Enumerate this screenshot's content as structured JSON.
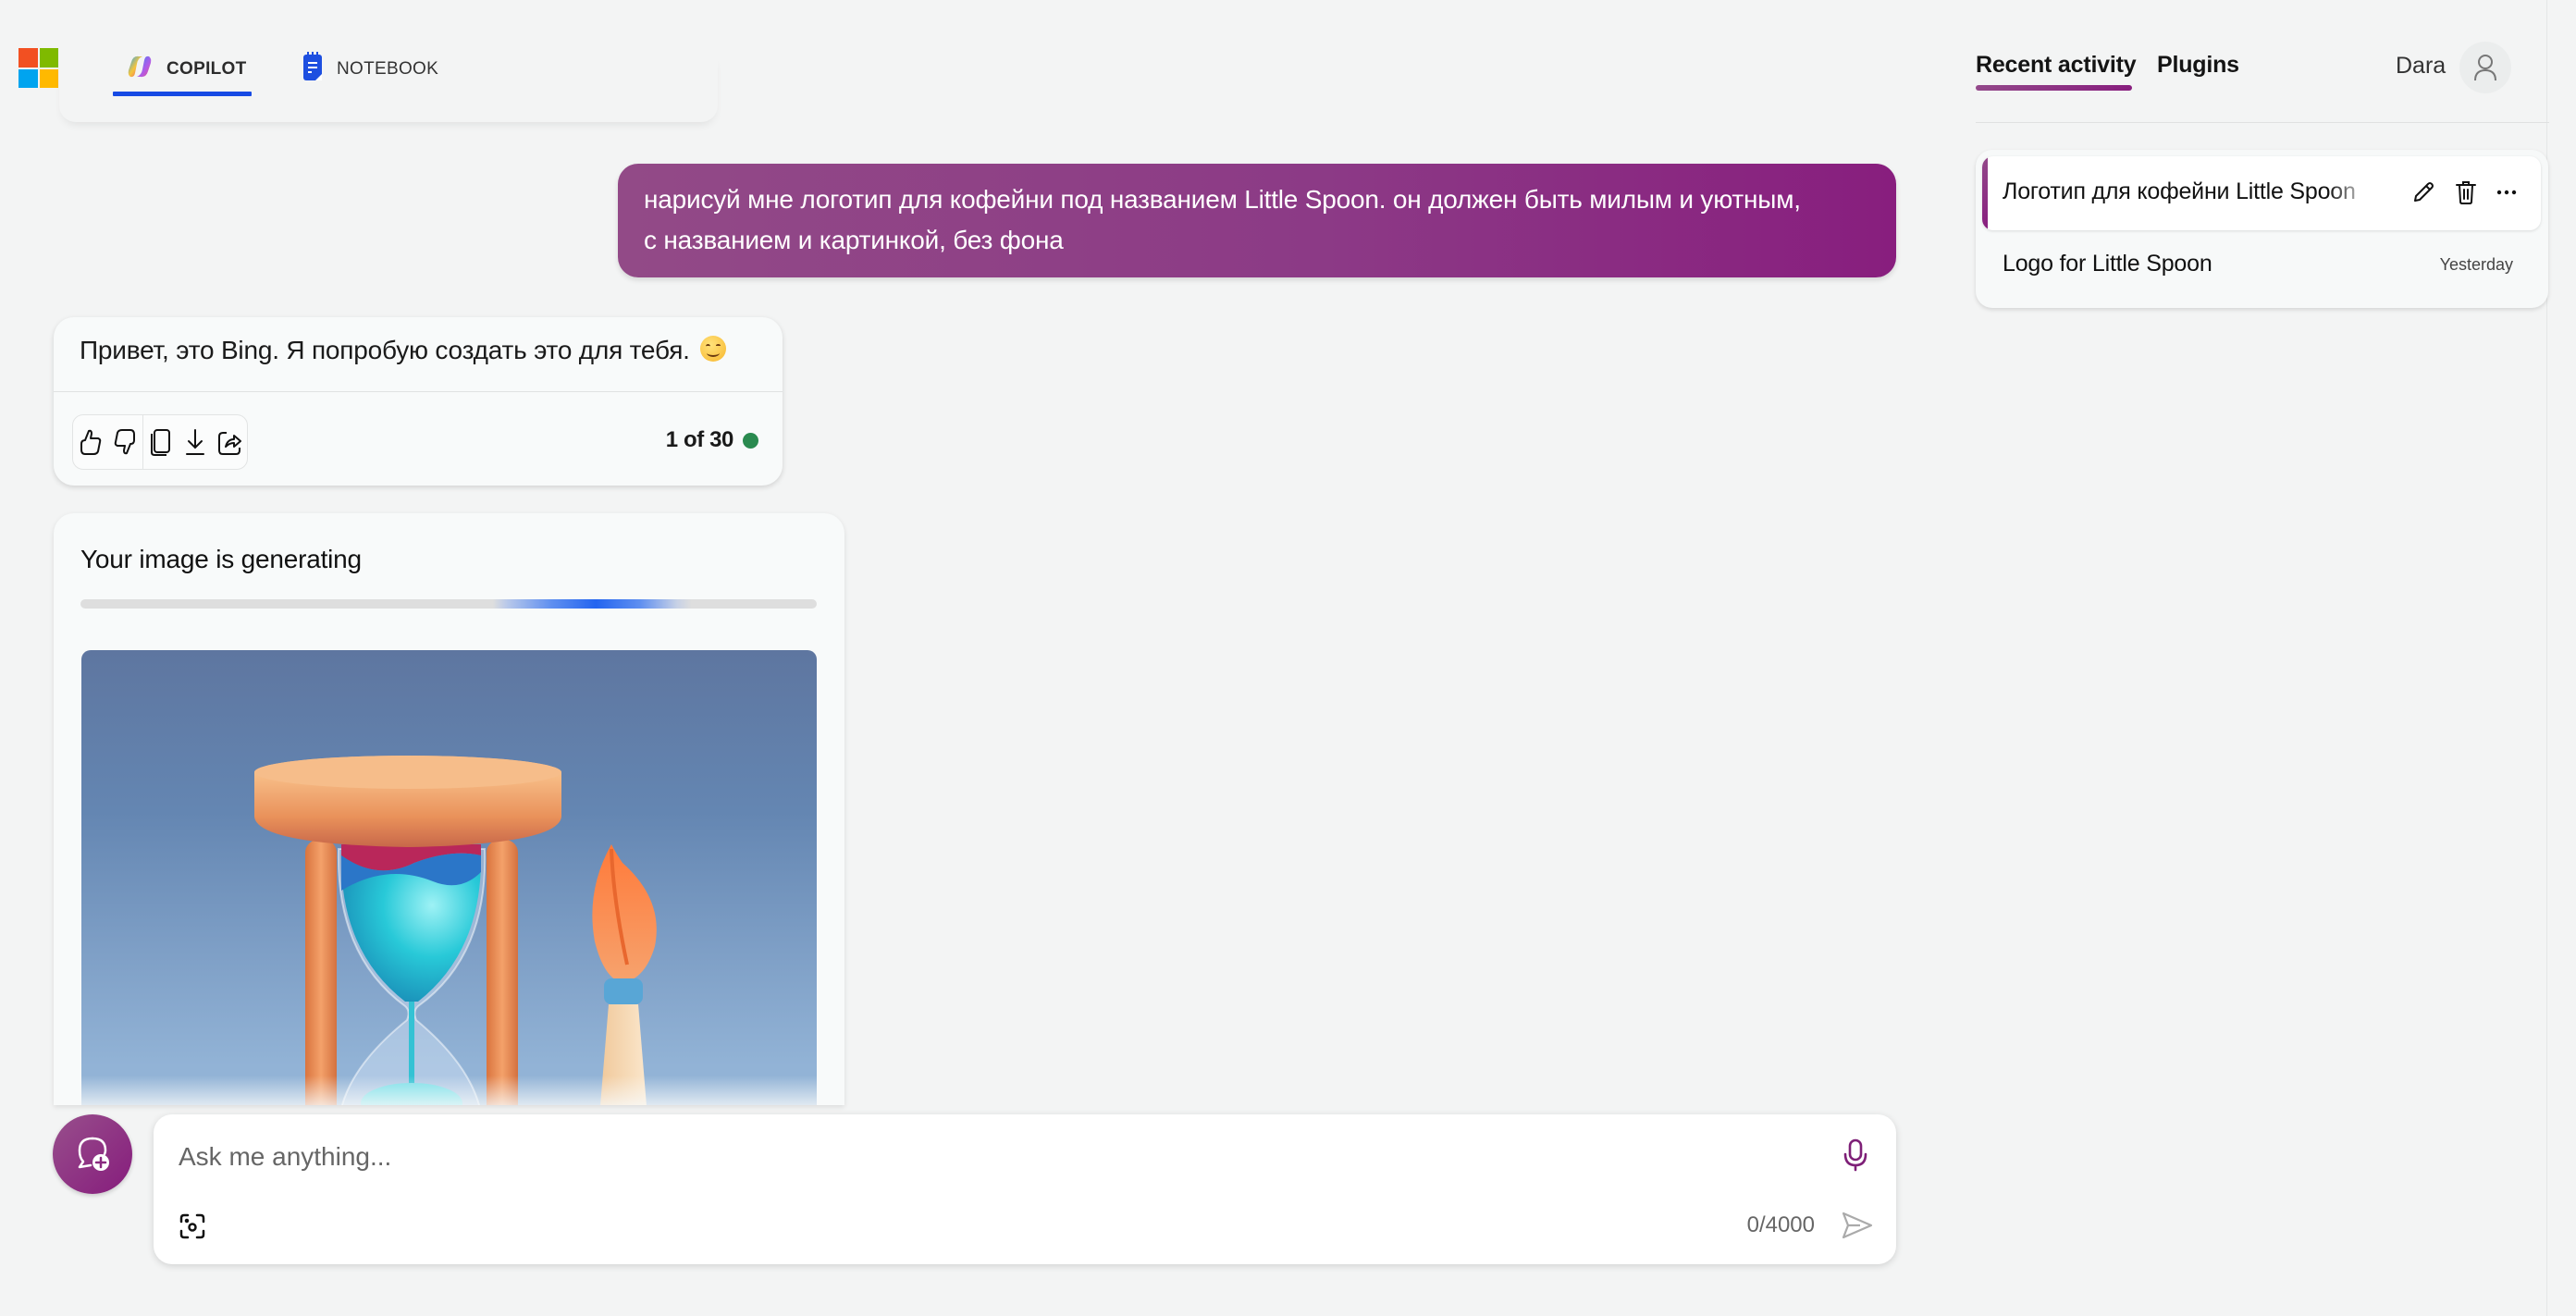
{
  "header": {
    "logo_colors": [
      "#f25022",
      "#7fba00",
      "#00a4ef",
      "#ffb900"
    ],
    "tabs": [
      {
        "label": "COPILOT",
        "icon": "copilot-icon",
        "active": true
      },
      {
        "label": "NOTEBOOK",
        "icon": "notebook-icon",
        "active": false
      }
    ],
    "accent_color": "#174ae4"
  },
  "conversation": {
    "user_message": {
      "lines": [
        "нарисуй мне логотип для кофейни под названием Little Spoon. он должен быть милым и уютным,",
        "с названием и картинкой, без фона"
      ]
    },
    "bot_message": {
      "text": "Привет, это Bing. Я попробую создать это для тебя.",
      "emoji": "smiling-face-emoji",
      "actions": [
        {
          "name": "like",
          "icon": "thumbs-up-icon"
        },
        {
          "name": "dislike",
          "icon": "thumbs-down-icon"
        },
        {
          "name": "copy",
          "icon": "copy-icon"
        },
        {
          "name": "export",
          "icon": "download-icon"
        },
        {
          "name": "share",
          "icon": "share-icon"
        }
      ],
      "turn_counter": "1 of 30",
      "status_color": "#2a8a4f"
    },
    "image_generation": {
      "title": "Your image is generating",
      "progress": "indeterminate",
      "preview_alt": "hourglass and paintbrush placeholder illustration"
    }
  },
  "composer": {
    "placeholder": "Ask me anything...",
    "value": "",
    "char_count": "0/4000",
    "new_topic_icon": "new-topic-chat-icon",
    "mic_icon": "microphone-icon",
    "visual_search_icon": "visual-search-icon",
    "send_icon": "send-icon",
    "brand_color": "#881e7e"
  },
  "right_panel": {
    "tabs": [
      {
        "label": "Recent activity",
        "active": true
      },
      {
        "label": "Plugins",
        "active": false
      }
    ],
    "user": {
      "name": "Dara",
      "avatar_icon": "person-icon"
    },
    "history": [
      {
        "title": "Логотип для кофейни Little Spoon",
        "active": true,
        "actions": [
          "edit",
          "delete",
          "more"
        ]
      },
      {
        "title": "Logo for Little Spoon",
        "time": "Yesterday",
        "active": false
      }
    ]
  }
}
